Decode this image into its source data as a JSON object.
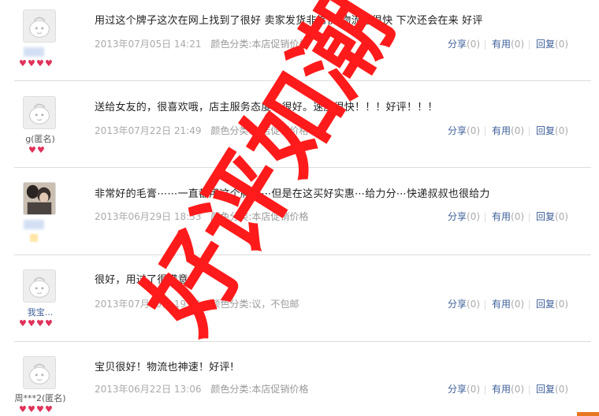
{
  "reviews": [
    {
      "username_visible": "",
      "content": "用过这个牌子这次在网上找到了很好 卖家发货非常快 物流也很快 下次还会在来 好评",
      "date": "2013年07月05日 14:21",
      "sku": "颜色分类:本店促销价格",
      "share_label": "分享",
      "share_count": "(0)",
      "useful_label": "有用",
      "useful_count": "(0)",
      "reply_label": "回复",
      "reply_count": "(0)"
    },
    {
      "username_visible": "g(匿名)",
      "content": "送给女友的，很喜欢哦，店主服务态度也很好。速度很快！！！好评！！！",
      "date": "2013年07月22日 21:49",
      "sku": "颜色分类:本店促销价格",
      "share_label": "分享",
      "share_count": "(0)",
      "useful_label": "有用",
      "useful_count": "(0)",
      "reply_label": "回复",
      "reply_count": "(0)"
    },
    {
      "username_visible": "",
      "content": "非常好的毛膏⋯⋯一直都用这个牌子⋯但是在这买好实惠⋯给力分⋯快递叔叔也很给力",
      "date": "2013年06月29日 18:33",
      "sku": "颜色分类:本店促销价格",
      "share_label": "分享",
      "share_count": "(0)",
      "useful_label": "有用",
      "useful_count": "(0)",
      "reply_label": "回复",
      "reply_count": "(0)"
    },
    {
      "username_visible": "我宝...",
      "content": "很好，用过了很满意",
      "date": "2013年07月05日 19:51",
      "sku": "颜色分类:议，不包邮",
      "share_label": "分享",
      "share_count": "(0)",
      "useful_label": "有用",
      "useful_count": "(0)",
      "reply_label": "回复",
      "reply_count": "(0)"
    },
    {
      "username_visible": "周***2(匿名)",
      "content": "宝贝很好！物流也神速！好评!",
      "date": "2013年06月22日 13:06",
      "sku": "颜色分类:本店促销价格",
      "share_label": "分享",
      "share_count": "(0)",
      "useful_label": "有用",
      "useful_count": "(0)",
      "reply_label": "回复",
      "reply_count": "(0)"
    }
  ],
  "stamp": {
    "text": "好评如潮",
    "color": "#ff1b1b"
  },
  "colors": {
    "link": "#3e5f99",
    "muted": "#aaaaaa",
    "heart": "#e0325a",
    "separator": "#dcdcdc"
  }
}
